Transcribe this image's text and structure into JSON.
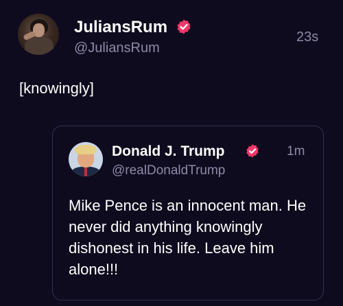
{
  "tweet": {
    "author": {
      "display_name": "JuliansRum",
      "handle": "@JuliansRum",
      "verified": true
    },
    "timestamp": "23s",
    "text": "[knowingly]",
    "quoted_tweet": {
      "author": {
        "display_name": "Donald J. Trump",
        "handle": "@realDonaldTrump",
        "verified": true
      },
      "timestamp": "1m",
      "text": "Mike Pence is an innocent man. He never did anything knowingly dishonest in his life. Leave him alone!!!"
    }
  },
  "colors": {
    "background": "#0f0b1e",
    "verified_badge": "#f0386b",
    "muted_text": "#8e8aa6",
    "card_border": "#34304a"
  },
  "icons": {
    "verified": "verified-badge-icon"
  }
}
